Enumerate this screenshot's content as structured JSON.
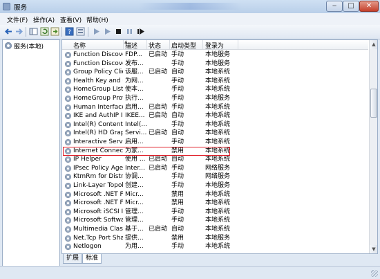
{
  "window": {
    "title": "服务"
  },
  "menu": [
    "文件(F)",
    "操作(A)",
    "查看(V)",
    "帮助(H)"
  ],
  "tree": {
    "root_label": "服务(本地)"
  },
  "table": {
    "columns": [
      "名称",
      "描述",
      "状态",
      "启动类型",
      "登录为"
    ],
    "rows": [
      [
        "Function Discover...",
        "FDP...",
        "已启动",
        "手动",
        "本地服务"
      ],
      [
        "Function Discover...",
        "发布...",
        "",
        "手动",
        "本地服务"
      ],
      [
        "Group Policy Client",
        "该服...",
        "已启动",
        "自动",
        "本地系统"
      ],
      [
        "Health Key and Ce...",
        "为网...",
        "",
        "手动",
        "本地系统"
      ],
      [
        "HomeGroup Liste...",
        "使本...",
        "",
        "手动",
        "本地系统"
      ],
      [
        "HomeGroup Provi...",
        "执行...",
        "",
        "手动",
        "本地服务"
      ],
      [
        "Human Interface ...",
        "启用...",
        "已启动",
        "手动",
        "本地系统"
      ],
      [
        "IKE and AuthIP IPs...",
        "IKEE...",
        "已启动",
        "自动",
        "本地系统"
      ],
      [
        "Intel(R) Content P...",
        "Intel(...",
        "",
        "手动",
        "本地系统"
      ],
      [
        "Intel(R) HD Graphi...",
        "Servi...",
        "已启动",
        "自动",
        "本地系统"
      ],
      [
        "Interactive Service...",
        "启用...",
        "",
        "手动",
        "本地系统"
      ],
      [
        "Internet Connecti...",
        "为家...",
        "",
        "禁用",
        "本地系统"
      ],
      [
        "IP Helper",
        "使用 ...",
        "已启动",
        "自动",
        "本地系统"
      ],
      [
        "IPsec Policy Agent",
        "Inter...",
        "已启动",
        "手动",
        "网络服务"
      ],
      [
        "KtmRm for Distrib...",
        "协调...",
        "",
        "手动",
        "网络服务"
      ],
      [
        "Link-Layer Topolo...",
        "创建...",
        "",
        "手动",
        "本地服务"
      ],
      [
        "Microsoft .NET Fr...",
        "Micr...",
        "",
        "禁用",
        "本地系统"
      ],
      [
        "Microsoft .NET Fr...",
        "Micr...",
        "",
        "禁用",
        "本地系统"
      ],
      [
        "Microsoft iSCSI Ini...",
        "管理...",
        "",
        "手动",
        "本地系统"
      ],
      [
        "Microsoft Softwar...",
        "管理...",
        "",
        "手动",
        "本地系统"
      ],
      [
        "Multimedia Class ...",
        "基于...",
        "已启动",
        "自动",
        "本地系统"
      ],
      [
        "Net.Tcp Port Shari...",
        "提供...",
        "",
        "禁用",
        "本地服务"
      ],
      [
        "Netlogon",
        "为用...",
        "",
        "手动",
        "本地系统"
      ]
    ],
    "highlighted_row": "Internet Connecti..."
  },
  "tabs": [
    "扩展",
    "标准"
  ],
  "colors": {
    "highlight_border": "#e0202a",
    "window_bg": "#dfe8f3"
  }
}
